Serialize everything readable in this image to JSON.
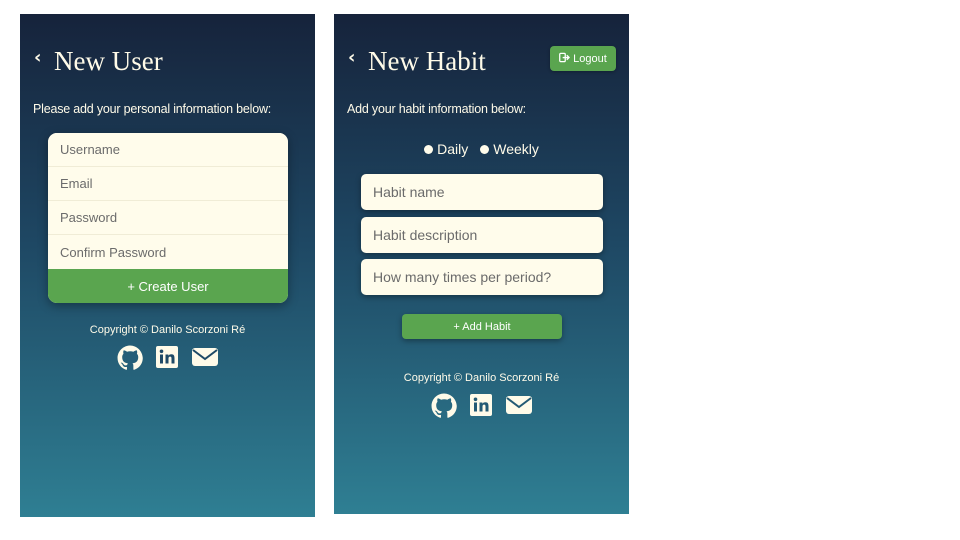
{
  "colors": {
    "accent_green": "#5aa54f",
    "cream": "#fffceb",
    "gradient_top": "#16233b",
    "gradient_bottom": "#2f7f93"
  },
  "new_user": {
    "back_icon": "chevron-left-icon",
    "title": "New User",
    "instructions": "Please add your personal information below:",
    "fields": {
      "username_placeholder": "Username",
      "email_placeholder": "Email",
      "password_placeholder": "Password",
      "confirm_password_placeholder": "Confirm Password"
    },
    "submit_label": "+ Create User",
    "footer": {
      "copyright": "Copyright © Danilo Scorzoni Ré",
      "social_icons": [
        "github-icon",
        "linkedin-icon",
        "email-icon"
      ]
    }
  },
  "new_habit": {
    "back_icon": "chevron-left-icon",
    "title": "New Habit",
    "logout_label": "Logout",
    "logout_icon": "logout-icon",
    "instructions": "Add your habit information below:",
    "period_options": {
      "daily": "Daily",
      "weekly": "Weekly"
    },
    "fields": {
      "name_placeholder": "Habit name",
      "description_placeholder": "Habit description",
      "times_placeholder": "How many times per period?"
    },
    "submit_label": "+ Add Habit",
    "footer": {
      "copyright": "Copyright © Danilo Scorzoni Ré",
      "social_icons": [
        "github-icon",
        "linkedin-icon",
        "email-icon"
      ]
    }
  }
}
